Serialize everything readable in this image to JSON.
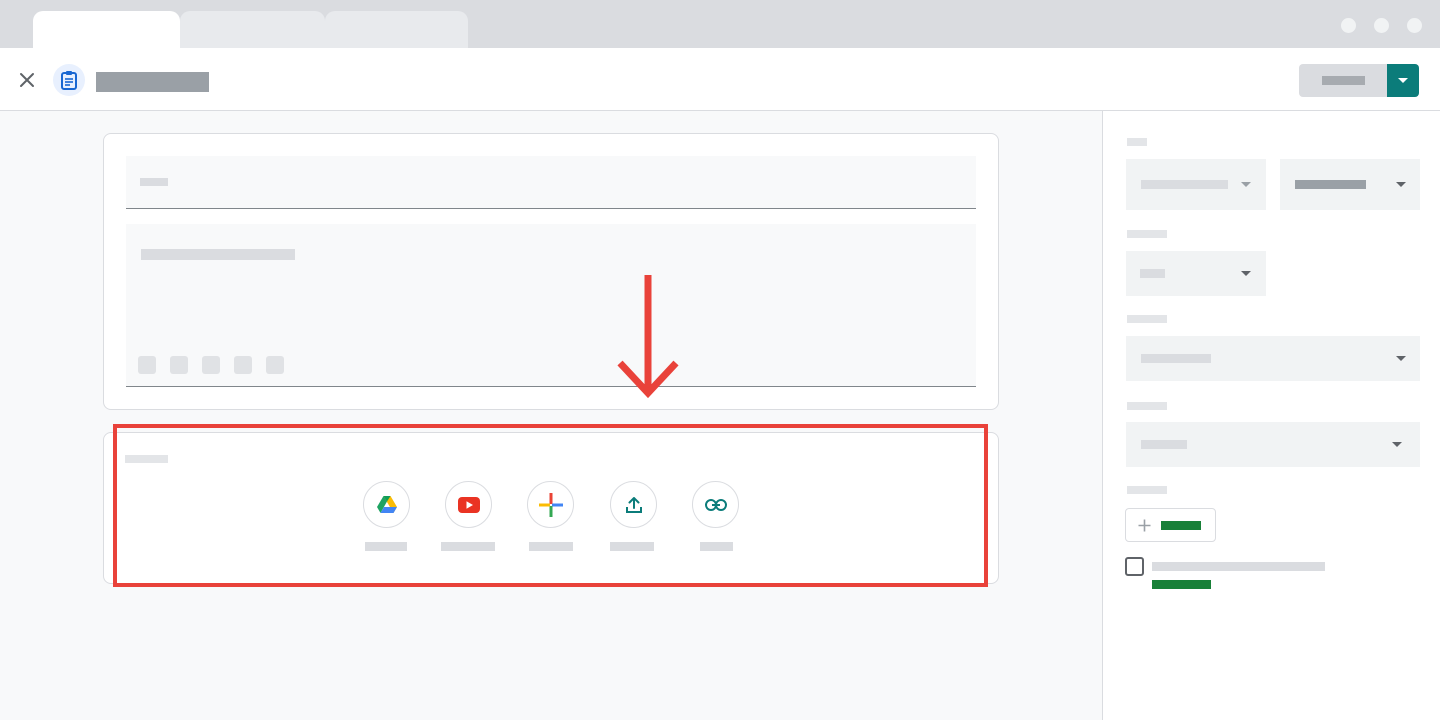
{
  "browser": {
    "tabs": [
      "",
      "",
      ""
    ],
    "window_controls": [
      "minimize-icon",
      "maximize-icon",
      "close-window-icon"
    ]
  },
  "header": {
    "close_icon": "close-icon",
    "app_icon": "assignment-icon",
    "title": "",
    "assign_button_label": "",
    "assign_menu_icon": "chevron-down-icon"
  },
  "main": {
    "title_placeholder": "",
    "instructions_placeholder": "",
    "formatting_buttons": [
      "bold-icon",
      "italic-icon",
      "underline-icon",
      "bulleted-list-icon",
      "clear-formatting-icon"
    ],
    "attach": {
      "label": "",
      "items": [
        {
          "icon": "google-drive-icon",
          "label": ""
        },
        {
          "icon": "youtube-icon",
          "label": ""
        },
        {
          "icon": "create-new-icon",
          "label": ""
        },
        {
          "icon": "upload-icon",
          "label": ""
        },
        {
          "icon": "link-icon",
          "label": ""
        }
      ]
    },
    "annotation": {
      "arrow": "down-arrow-icon",
      "color": "#e9423a"
    }
  },
  "side_panel": {
    "sections": [
      {
        "label": "",
        "dropdowns": [
          {
            "value": ""
          },
          {
            "value": ""
          }
        ]
      },
      {
        "label": "",
        "dropdowns": [
          {
            "value": ""
          }
        ]
      },
      {
        "label": "",
        "dropdowns": [
          {
            "value": ""
          }
        ]
      },
      {
        "label": "",
        "dropdowns": [
          {
            "value": ""
          }
        ]
      },
      {
        "label": "",
        "add_button": {
          "icon": "plus-icon",
          "label": ""
        }
      }
    ],
    "checkbox": {
      "checked": false,
      "label": "",
      "sublabel": ""
    }
  },
  "colors": {
    "accent": "#0b7c7a",
    "green": "#188038",
    "highlight": "#e9423a",
    "placeholder": "#dadce0"
  }
}
